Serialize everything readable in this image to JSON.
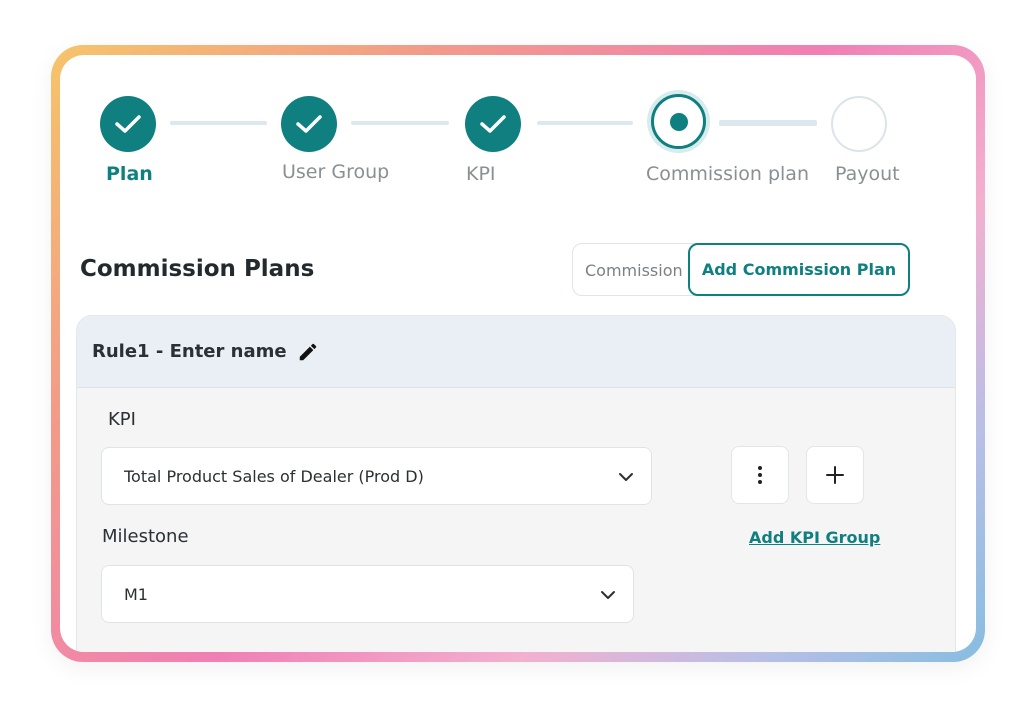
{
  "stepper": {
    "steps": [
      {
        "label": "Plan",
        "state": "done"
      },
      {
        "label": "User Group",
        "state": "done"
      },
      {
        "label": "KPI",
        "state": "done"
      },
      {
        "label": "Commission plan",
        "state": "current"
      },
      {
        "label": "Payout",
        "state": "todo"
      }
    ]
  },
  "section": {
    "title": "Commission Plans",
    "toggle": {
      "commission_label": "Commission",
      "add_label": "Add Commission Plan"
    }
  },
  "rule": {
    "title": "Rule1 - Enter name",
    "kpi": {
      "label": "KPI",
      "selected": "Total Product Sales of Dealer (Prod D)"
    },
    "milestone": {
      "label": "Milestone",
      "selected": "M1"
    },
    "add_kpi_group_label": "Add KPI Group"
  },
  "icons": [
    "check-icon",
    "pencil-icon",
    "chevron-down-icon",
    "more-vertical-icon",
    "plus-icon"
  ],
  "colors": {
    "accent": "#0f7f7f",
    "panel_header": "#e9eff5",
    "panel_body": "#f5f5f6"
  }
}
